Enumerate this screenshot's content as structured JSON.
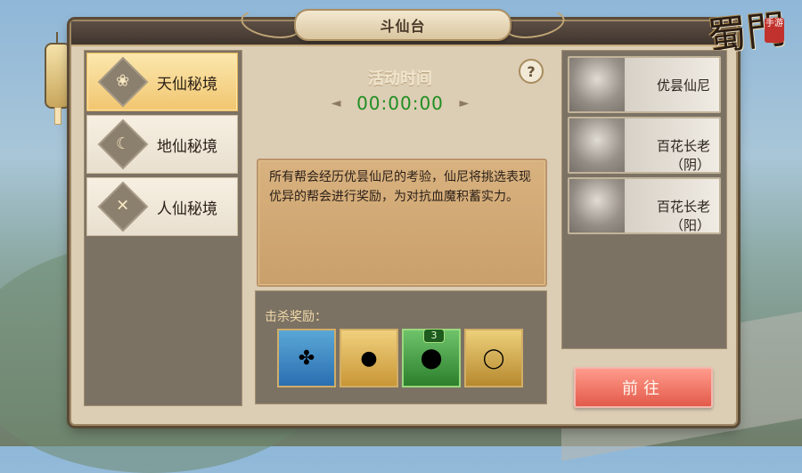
{
  "window": {
    "title": "斗仙台",
    "logo": {
      "main": "蜀門",
      "seal": "手游"
    }
  },
  "left_tabs": [
    {
      "label": "天仙秘境",
      "icon": "lotus-icon",
      "selected": true
    },
    {
      "label": "地仙秘境",
      "icon": "moon-cloud-icon",
      "selected": false
    },
    {
      "label": "人仙秘境",
      "icon": "crossed-swords-icon",
      "selected": false
    }
  ],
  "activity": {
    "title": "活动时间",
    "time": "00:00:00",
    "help": "?"
  },
  "description": "所有帮会经历优昙仙尼的考验，仙尼将挑选表现优异的帮会进行奖励，为对抗血魔积蓄实力。",
  "rewards": {
    "label": "击杀奖励：",
    "items": [
      {
        "name": "jade-amulet-icon",
        "bg": "blue"
      },
      {
        "name": "purple-gem-egg-icon",
        "bg": "purple"
      },
      {
        "name": "green-orb-icon",
        "bg": "green",
        "badge": "3"
      },
      {
        "name": "ring-icon",
        "bg": "gold"
      }
    ]
  },
  "bosses": [
    {
      "name": "优昙仙尼"
    },
    {
      "name": "百花长老（阴）"
    },
    {
      "name": "百花长老（阳）"
    }
  ],
  "actions": {
    "go_label": "前往"
  },
  "colors": {
    "accent_green": "#1f8e21",
    "button_red": "#e35a4a",
    "panel_bg": "#dccdb5"
  }
}
